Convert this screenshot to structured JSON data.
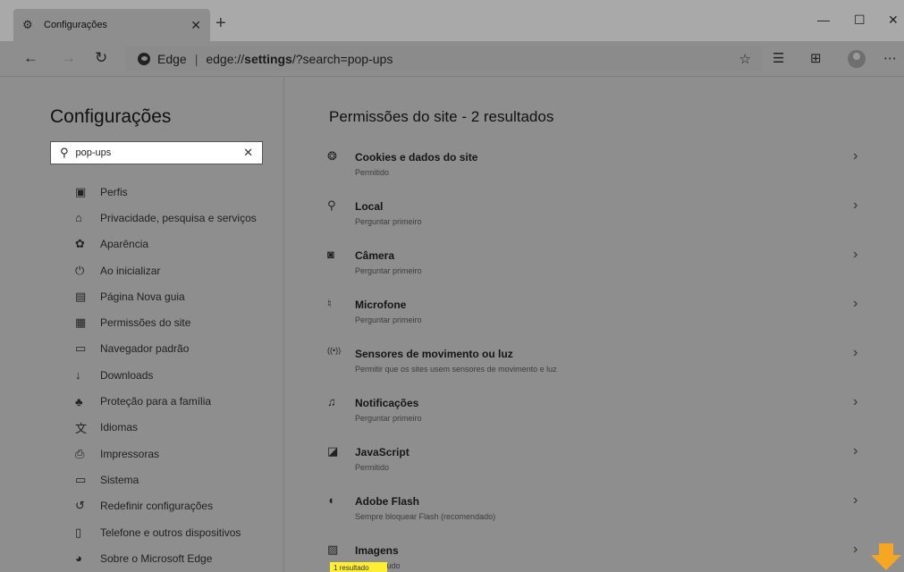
{
  "tab": {
    "title": "Configurações",
    "close": "✕"
  },
  "window": {
    "new_tab": "+",
    "minimize": "—",
    "maximize": "☐",
    "close": "✕"
  },
  "address": {
    "brand": "Edge",
    "separator": "|",
    "url_prefix": "edge://",
    "url_host": "settings",
    "url_rest": "/?search=pop-ups"
  },
  "sidebar": {
    "title": "Configurações",
    "search": {
      "value": "pop-ups",
      "clear": "✕"
    },
    "items": [
      {
        "label": "Perfis",
        "icon": "profile-icon"
      },
      {
        "label": "Privacidade, pesquisa e serviços",
        "icon": "lock-icon"
      },
      {
        "label": "Aparência",
        "icon": "palette-icon"
      },
      {
        "label": "Ao inicializar",
        "icon": "power-icon"
      },
      {
        "label": "Página Nova guia",
        "icon": "new-tab-page-icon"
      },
      {
        "label": "Permissões do site",
        "icon": "site-permissions-icon"
      },
      {
        "label": "Navegador padrão",
        "icon": "browser-icon"
      },
      {
        "label": "Downloads",
        "icon": "download-icon"
      },
      {
        "label": "Proteção para a família",
        "icon": "family-icon"
      },
      {
        "label": "Idiomas",
        "icon": "languages-icon"
      },
      {
        "label": "Impressoras",
        "icon": "printer-icon"
      },
      {
        "label": "Sistema",
        "icon": "system-icon"
      },
      {
        "label": "Redefinir configurações",
        "icon": "reset-icon"
      },
      {
        "label": "Telefone e outros dispositivos",
        "icon": "phone-icon"
      },
      {
        "label": "Sobre o Microsoft Edge",
        "icon": "edge-logo-icon"
      }
    ]
  },
  "main": {
    "title": "Permissões do site - 2 resultados",
    "items": [
      {
        "name": "Cookies e dados do site",
        "desc": "Permitido",
        "icon": "cookie-icon"
      },
      {
        "name": "Local",
        "desc": "Perguntar primeiro",
        "icon": "location-icon"
      },
      {
        "name": "Câmera",
        "desc": "Perguntar primeiro",
        "icon": "camera-icon"
      },
      {
        "name": "Microfone",
        "desc": "Perguntar primeiro",
        "icon": "microphone-icon"
      },
      {
        "name": "Sensores de movimento ou luz",
        "desc": "Permitir que os sites usem sensores de movimento e luz",
        "icon": "sensor-icon"
      },
      {
        "name": "Notificações",
        "desc": "Perguntar primeiro",
        "icon": "bell-icon"
      },
      {
        "name": "JavaScript",
        "desc": "Permitido",
        "icon": "javascript-icon"
      },
      {
        "name": "Adobe Flash",
        "desc": "Sempre bloquear Flash (recomendado)",
        "icon": "puzzle-icon"
      },
      {
        "name": "Imagens",
        "desc": "Mostrar tudo",
        "icon": "image-icon"
      }
    ],
    "tooltip": "1 resultado"
  },
  "colors": {
    "overlay": "#8e8e8e",
    "highlight": "#ffee33",
    "arrow": "#f5a623"
  }
}
